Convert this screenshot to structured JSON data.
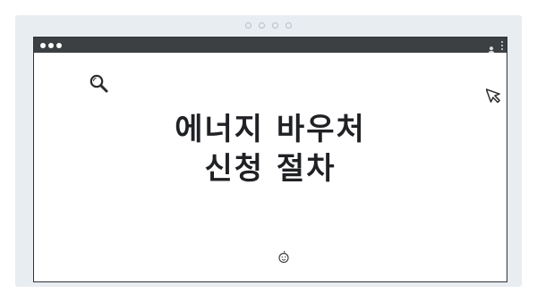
{
  "pager": {
    "count": 4
  },
  "window": {
    "dots": 3
  },
  "icons": {
    "search": "search-icon",
    "cursor": "cursor-arrow-icon",
    "profile": "profile-icon",
    "menu": "kebab-menu-icon",
    "emoji": "smiley-icon"
  },
  "main": {
    "title_line1": "에너지 바우처",
    "title_line2": "신청 절차"
  },
  "colors": {
    "frame": "#e8edf2",
    "titlebar": "#3c4043",
    "text": "#202124"
  }
}
